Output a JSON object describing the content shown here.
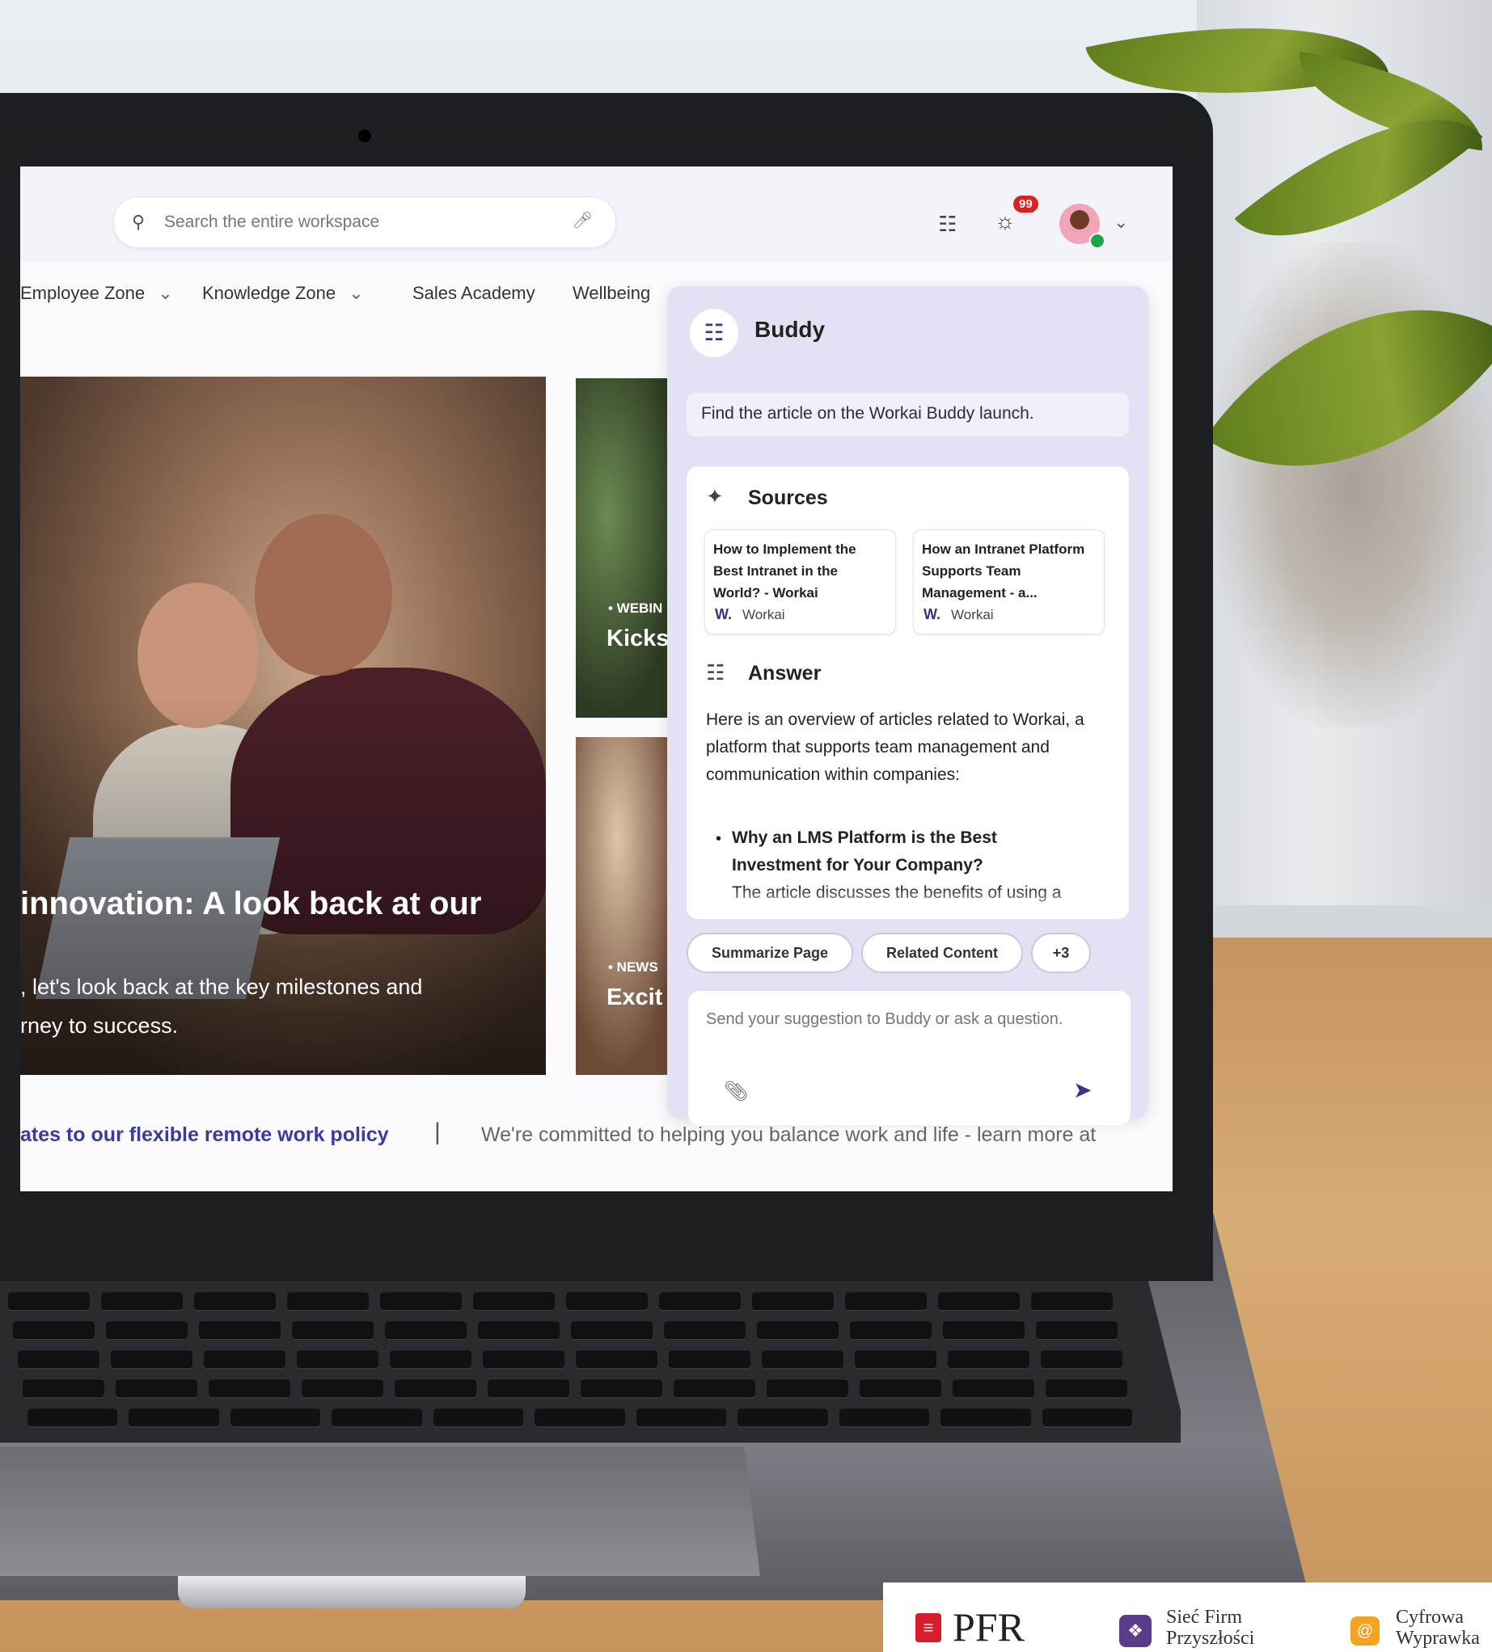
{
  "header": {
    "search_placeholder": "Search the entire workspace",
    "notifications_count": "99"
  },
  "nav": {
    "items": [
      {
        "label": "Employee Zone",
        "chevron": true
      },
      {
        "label": "Knowledge Zone",
        "chevron": true
      },
      {
        "label": "Sales Academy",
        "chevron": false
      },
      {
        "label": "Wellbeing",
        "chevron": false
      }
    ]
  },
  "hero": {
    "title": "innovation: A look back at our",
    "desc_line1": ", let's look back at the key milestones and",
    "desc_line2": "rney to success."
  },
  "cards": [
    {
      "tag": "• WEBIN",
      "title": "Kicks empl"
    },
    {
      "tag": "• NEWS",
      "title": "Excit horiz"
    }
  ],
  "ticker": {
    "left": "ates to our flexible remote work policy",
    "separator": "|",
    "right": "We're committed to helping you balance work and life - learn more at"
  },
  "buddy": {
    "title": "Buddy",
    "prompt": "Find the article on the Workai Buddy launch.",
    "sources_title": "Sources",
    "sources": [
      {
        "title": "How to Implement the Best Intranet in the World? - Workai",
        "logo": "W.",
        "site": "Workai"
      },
      {
        "title": "How an Intranet Platform Supports Team Management - a...",
        "logo": "W.",
        "site": "Workai"
      }
    ],
    "answer_title": "Answer",
    "answer_text": "Here is an overview of articles related to Workai, a platform that supports team management and communication within companies:",
    "bullet_title": "Why an LMS Platform is the Best Investment for Your Company?",
    "bullet_text": "The article discusses the benefits of using a",
    "chips": [
      "Summarize Page",
      "Related Content",
      "+3"
    ],
    "composer_placeholder": "Send your suggestion to Buddy or ask a question."
  },
  "logos": {
    "pfr": "PFR",
    "sfp_line1": "Sieć Firm",
    "sfp_line2": "Przyszłości",
    "cw_line1": "Cyfrowa",
    "cw_line2": "Wyprawka"
  },
  "colors": {
    "accent": "#3e2f8c",
    "panel_bg": "#e4e1f5",
    "badge": "#e02020",
    "ticker_link": "#3a3aa0"
  },
  "icons": {
    "search": "search-icon",
    "mic": "microphone-icon",
    "buddy": "buddy-bot-icon",
    "bell": "bell-icon",
    "chevron": "chevron-down-icon",
    "sources": "magic-wand-icon",
    "answer": "bot-icon",
    "attach": "paperclip-icon",
    "send": "send-icon"
  }
}
